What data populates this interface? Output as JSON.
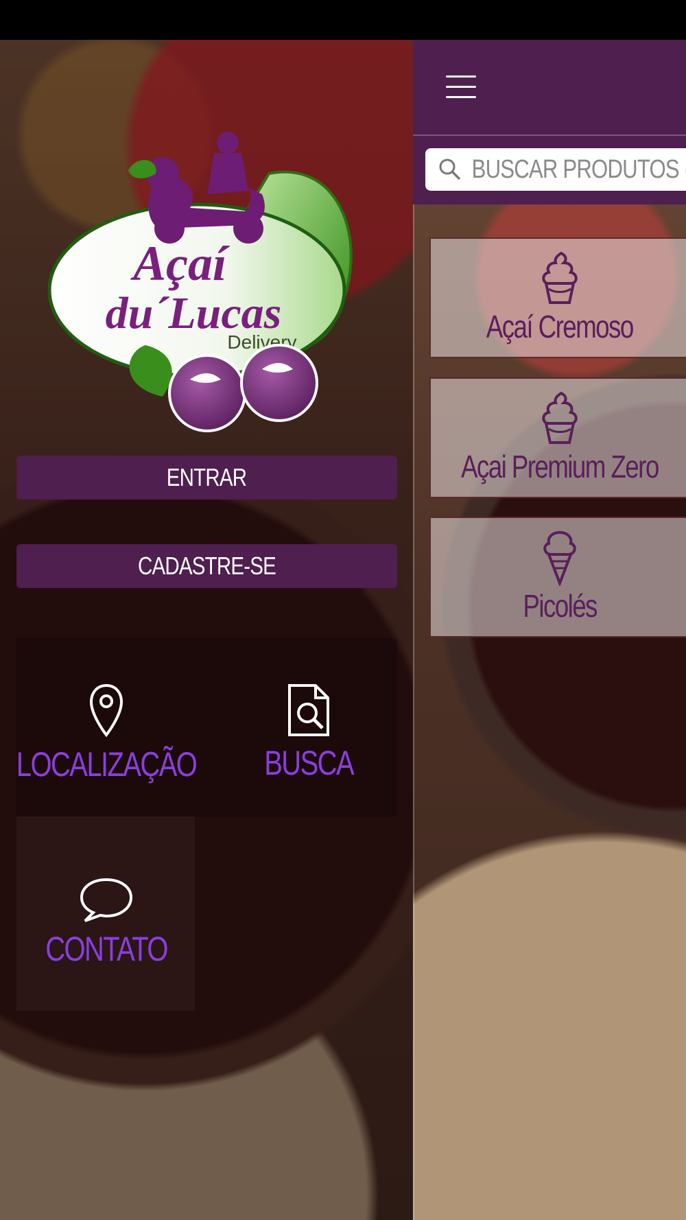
{
  "drawer": {
    "logo": {
      "line1": "Açaí",
      "line2": "du´Lucas",
      "line3": "Delivery"
    },
    "buttons": {
      "login": "ENTRAR",
      "register": "CADASTRE-SE"
    },
    "quick_links": [
      {
        "label": "LOCALIZAÇÃO",
        "icon": "map-pin-icon"
      },
      {
        "label": "BUSCA",
        "icon": "document-search-icon"
      },
      {
        "label": "CONTATO",
        "icon": "chat-bubble-icon"
      }
    ]
  },
  "main": {
    "menu_icon": "hamburger-icon",
    "search": {
      "placeholder": "BUSCAR PRODUTOS (E",
      "icon": "search-icon"
    },
    "categories": [
      {
        "label": "Açaí Cremoso",
        "icon": "cupcake-icon"
      },
      {
        "label": "Açai Premium Zero",
        "icon": "cupcake-icon"
      },
      {
        "label": "Picolés",
        "icon": "ice-cream-cone-icon"
      }
    ]
  },
  "colors": {
    "brand_purple": "#4e1f4f",
    "accent_violet": "#8a3ee0",
    "category_text": "#5a1f5a"
  }
}
